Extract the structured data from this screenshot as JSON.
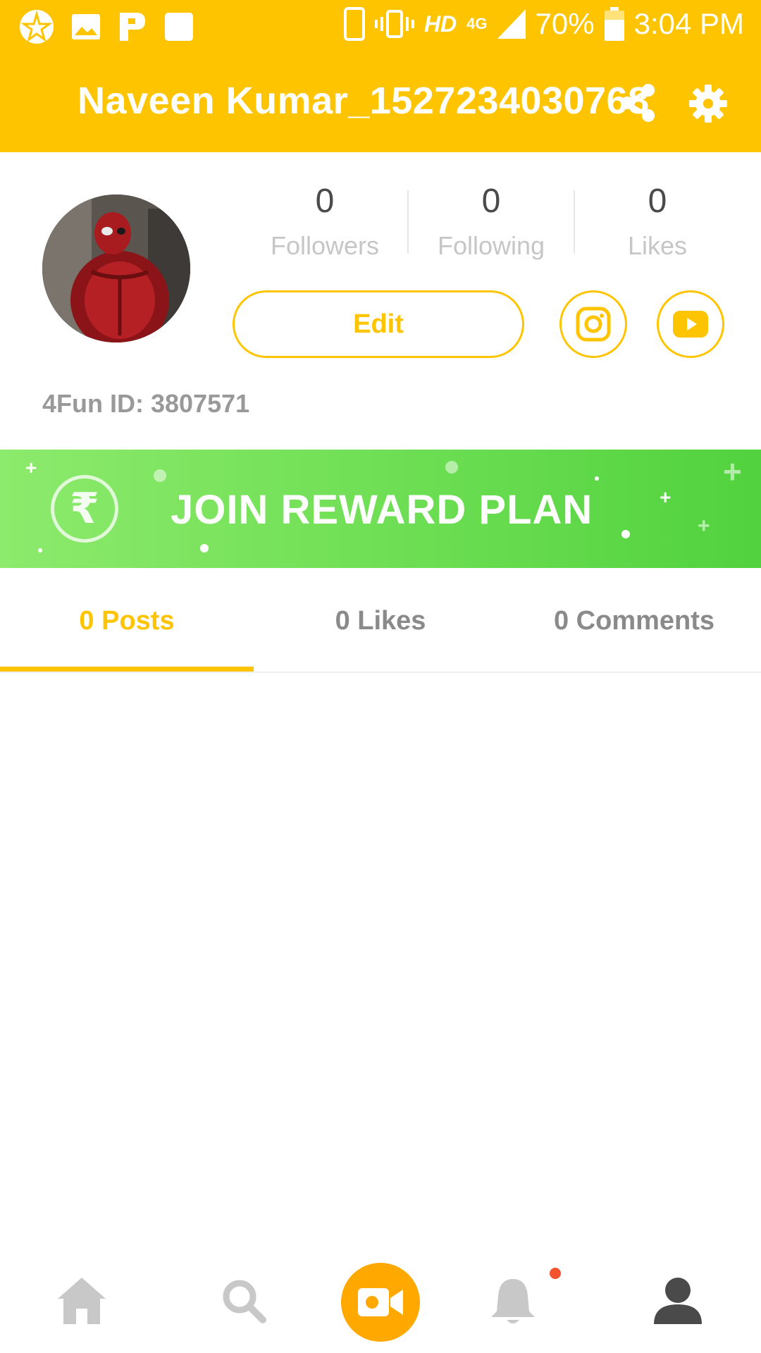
{
  "status_bar": {
    "hd": "HD",
    "network": "4G",
    "battery": "70%",
    "time": "3:04 PM"
  },
  "header": {
    "title": "Naveen Kumar_1527234030768"
  },
  "profile": {
    "stats": [
      {
        "value": "0",
        "label": "Followers"
      },
      {
        "value": "0",
        "label": "Following"
      },
      {
        "value": "0",
        "label": "Likes"
      }
    ],
    "edit_label": "Edit",
    "fun_id": "4Fun ID: 3807571"
  },
  "banner": {
    "currency_symbol": "₹",
    "text": "JOIN REWARD PLAN"
  },
  "tabs": [
    {
      "label": "0 Posts",
      "active": true
    },
    {
      "label": "0 Likes",
      "active": false
    },
    {
      "label": "0 Comments",
      "active": false
    }
  ],
  "bottom_nav": {
    "items": [
      "home-icon",
      "search-icon",
      "video-camera-icon",
      "bell-icon",
      "profile-icon"
    ],
    "active": "profile-icon"
  },
  "colors": {
    "brand_yellow": "#FFC400",
    "banner_green": "#6FDF55",
    "record_orange": "#FFA800",
    "notification_red": "#F4532D"
  }
}
